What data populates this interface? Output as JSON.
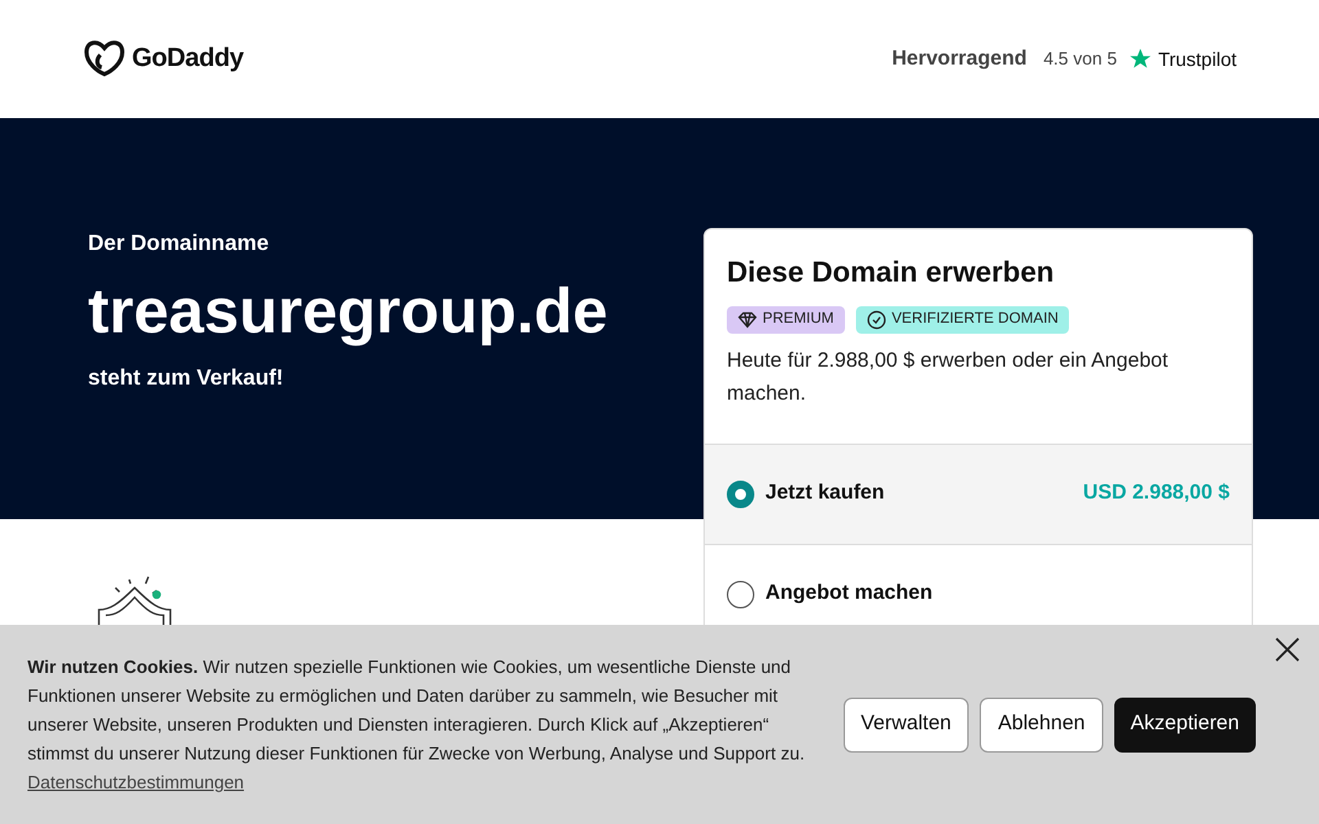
{
  "header": {
    "logo": "GoDaddy",
    "rating_label": "Hervorragend",
    "rating_score": "4.5 von 5",
    "trustpilot": "Trustpilot"
  },
  "hero": {
    "eyebrow": "Der Domainname",
    "domain": "treasuregroup.de",
    "tagline": "steht zum Verkauf!"
  },
  "card": {
    "title": "Diese Domain erwerben",
    "badges": [
      {
        "kind": "premium",
        "label": "PREMIUM",
        "color": "#d9c8f5"
      },
      {
        "kind": "verified",
        "label": "VERIFIZIERTE DOMAIN",
        "color": "#9ff0e8"
      }
    ],
    "description": "Heute für 2.988,00 $ erwerben oder ein Angebot machen.",
    "options": [
      {
        "label": "Jetzt kaufen",
        "price": "USD 2.988,00 $",
        "selected": true
      },
      {
        "label": "Angebot machen",
        "selected": false
      }
    ]
  },
  "cookie_banner": {
    "text": "**Wir nutzen Cookies.** Wir nutzen spezielle Funktionen wie Cookies, um wesentliche Dienste und Funktionen unserer Website zu ermöglichen und Daten darüber zu sammeln, wie Besucher mit unserer Website, unseren Produkten und Diensten interagieren. Durch Klick auf „Akzeptieren“ stimmst du unserer Nutzung dieser Funktionen für Zwecke von Werbung, Analyse und Support zu.",
    "link": "Datenschutzbestimmungen",
    "buttons": [
      {
        "label": "Verwalten",
        "kind": "outline"
      },
      {
        "label": "Ablehnen",
        "kind": "outline"
      },
      {
        "label": "Akzeptieren",
        "kind": "primary"
      }
    ]
  }
}
